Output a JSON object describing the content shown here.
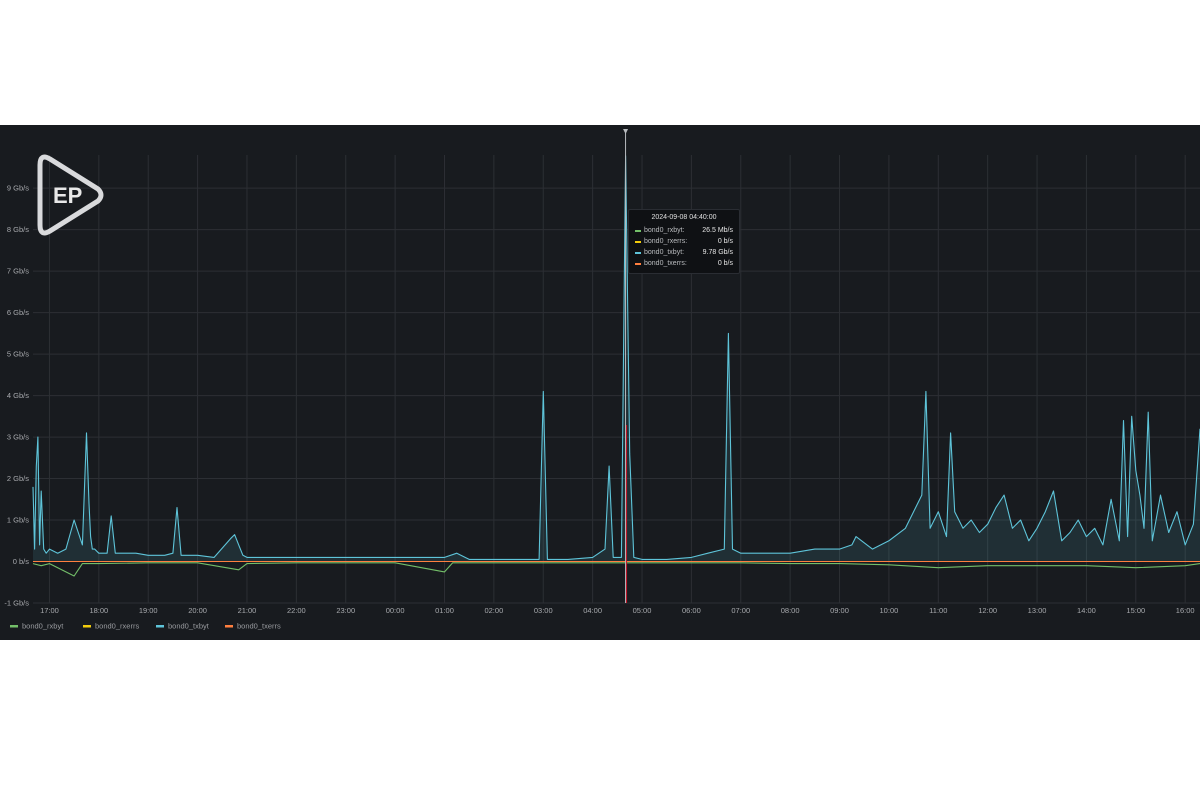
{
  "logo": {
    "text": "EP"
  },
  "tooltip": {
    "time": "2024-09-08 04:40:00",
    "rows": [
      {
        "name": "bond0_rxbyt:",
        "value": "26.5 Mb/s",
        "color": "#73bf69"
      },
      {
        "name": "bond0_rxerrs:",
        "value": "0 b/s",
        "color": "#f2cc0c"
      },
      {
        "name": "bond0_txbyt:",
        "value": "9.78 Gb/s",
        "color": "#5ec4d9"
      },
      {
        "name": "bond0_txerrs:",
        "value": "0 b/s",
        "color": "#ff7f3f"
      }
    ]
  },
  "chart_data": {
    "type": "line",
    "y_unit": "Gb/s",
    "ylim": [
      -1,
      9.8
    ],
    "yticks": [
      "9 Gb/s",
      "8 Gb/s",
      "7 Gb/s",
      "6 Gb/s",
      "5 Gb/s",
      "4 Gb/s",
      "3 Gb/s",
      "2 Gb/s",
      "1 Gb/s",
      "0 b/s",
      "-1 Gb/s"
    ],
    "ytick_values": [
      9,
      8,
      7,
      6,
      5,
      4,
      3,
      2,
      1,
      0,
      -1
    ],
    "xlim": [
      "16:40",
      "16:18"
    ],
    "xticks": [
      "17:00",
      "18:00",
      "19:00",
      "20:00",
      "21:00",
      "22:00",
      "23:00",
      "00:00",
      "01:00",
      "02:00",
      "03:00",
      "04:00",
      "05:00",
      "06:00",
      "07:00",
      "08:00",
      "09:00",
      "10:00",
      "11:00",
      "12:00",
      "13:00",
      "14:00",
      "15:00",
      "16:00"
    ],
    "grid": true,
    "legend_position": "bottom-left",
    "cursor_time": "04:40",
    "series": [
      {
        "name": "bond0_txbyt",
        "color": "#5ec4d9",
        "x": [
          "16:40",
          "16:42",
          "16:44",
          "16:46",
          "16:48",
          "16:50",
          "16:53",
          "16:56",
          "17:00",
          "17:10",
          "17:20",
          "17:30",
          "17:40",
          "17:45",
          "17:48",
          "17:50",
          "17:52",
          "17:55",
          "18:00",
          "18:10",
          "18:15",
          "18:20",
          "18:30",
          "18:45",
          "19:00",
          "19:20",
          "19:30",
          "19:35",
          "19:40",
          "20:00",
          "20:20",
          "20:40",
          "20:45",
          "20:50",
          "20:55",
          "21:00",
          "21:10",
          "21:30",
          "22:00",
          "22:30",
          "23:00",
          "23:30",
          "00:00",
          "00:30",
          "01:00",
          "01:15",
          "01:30",
          "02:00",
          "02:30",
          "02:55",
          "03:00",
          "03:05",
          "03:30",
          "04:00",
          "04:15",
          "04:20",
          "04:25",
          "04:35",
          "04:40",
          "04:45",
          "04:50",
          "05:00",
          "05:30",
          "06:00",
          "06:20",
          "06:40",
          "06:45",
          "06:50",
          "07:00",
          "07:30",
          "08:00",
          "08:30",
          "09:00",
          "09:15",
          "09:20",
          "09:40",
          "10:00",
          "10:20",
          "10:40",
          "10:45",
          "10:50",
          "11:00",
          "11:10",
          "11:15",
          "11:20",
          "11:30",
          "11:40",
          "11:50",
          "12:00",
          "12:10",
          "12:20",
          "12:30",
          "12:40",
          "12:50",
          "13:00",
          "13:10",
          "13:20",
          "13:30",
          "13:40",
          "13:50",
          "14:00",
          "14:10",
          "14:20",
          "14:30",
          "14:40",
          "14:45",
          "14:50",
          "14:55",
          "15:00",
          "15:05",
          "15:10",
          "15:15",
          "15:20",
          "15:30",
          "15:40",
          "15:50",
          "16:00",
          "16:10",
          "16:18"
        ],
        "y": [
          1.8,
          0.3,
          2.3,
          3.0,
          0.4,
          1.7,
          0.3,
          0.2,
          0.3,
          0.2,
          0.3,
          1.0,
          0.4,
          3.1,
          1.4,
          0.6,
          0.3,
          0.3,
          0.2,
          0.2,
          1.1,
          0.2,
          0.2,
          0.2,
          0.15,
          0.15,
          0.2,
          1.3,
          0.15,
          0.15,
          0.1,
          0.55,
          0.65,
          0.4,
          0.15,
          0.1,
          0.1,
          0.1,
          0.1,
          0.1,
          0.1,
          0.1,
          0.1,
          0.1,
          0.1,
          0.2,
          0.05,
          0.05,
          0.05,
          0.05,
          4.1,
          0.05,
          0.05,
          0.1,
          0.3,
          2.3,
          0.1,
          0.1,
          9.78,
          2.6,
          0.1,
          0.05,
          0.05,
          0.1,
          0.2,
          0.3,
          5.5,
          0.3,
          0.2,
          0.2,
          0.2,
          0.3,
          0.3,
          0.4,
          0.6,
          0.3,
          0.5,
          0.8,
          1.6,
          4.1,
          0.8,
          1.2,
          0.6,
          3.1,
          1.2,
          0.8,
          1.0,
          0.7,
          0.9,
          1.3,
          1.6,
          0.8,
          1.0,
          0.5,
          0.8,
          1.2,
          1.7,
          0.5,
          0.7,
          1.0,
          0.6,
          0.8,
          0.4,
          1.5,
          0.5,
          3.4,
          0.6,
          3.5,
          2.2,
          1.6,
          0.8,
          3.6,
          0.5,
          1.6,
          0.7,
          1.2,
          0.4,
          0.9,
          3.2
        ]
      },
      {
        "name": "bond0_rxbyt",
        "color": "#73bf69",
        "x": [
          "16:40",
          "16:50",
          "17:00",
          "17:30",
          "17:40",
          "18:00",
          "19:00",
          "20:00",
          "20:50",
          "21:00",
          "22:00",
          "23:00",
          "00:00",
          "01:00",
          "01:10",
          "02:00",
          "03:00",
          "04:00",
          "04:40",
          "05:00",
          "06:00",
          "07:00",
          "08:00",
          "09:00",
          "10:00",
          "11:00",
          "12:00",
          "13:00",
          "14:00",
          "15:00",
          "16:00",
          "16:18"
        ],
        "y": [
          -0.05,
          -0.1,
          -0.05,
          -0.35,
          -0.05,
          -0.05,
          -0.03,
          -0.03,
          -0.2,
          -0.05,
          -0.03,
          -0.03,
          -0.03,
          -0.25,
          -0.03,
          -0.03,
          -0.03,
          -0.03,
          -0.03,
          -0.03,
          -0.03,
          -0.03,
          -0.05,
          -0.05,
          -0.08,
          -0.15,
          -0.1,
          -0.1,
          -0.1,
          -0.15,
          -0.1,
          -0.05
        ]
      },
      {
        "name": "bond0_rxerrs",
        "color": "#f2cc0c",
        "x": [
          "16:40",
          "16:18"
        ],
        "y": [
          0,
          0
        ]
      },
      {
        "name": "bond0_txerrs",
        "color": "#ff7f3f",
        "x": [
          "16:40",
          "16:18"
        ],
        "y": [
          0,
          0
        ]
      }
    ],
    "legend": [
      "bond0_rxbyt",
      "bond0_rxerrs",
      "bond0_txbyt",
      "bond0_txerrs"
    ]
  }
}
